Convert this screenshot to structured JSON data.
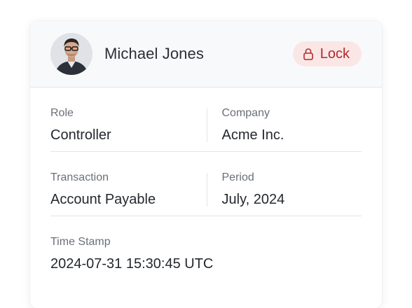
{
  "header": {
    "user_name": "Michael Jones",
    "avatar_icon": "user-photo",
    "lock": {
      "label": "Lock",
      "icon": "lock-icon"
    }
  },
  "fields": {
    "role": {
      "label": "Role",
      "value": "Controller"
    },
    "company": {
      "label": "Company",
      "value": "Acme Inc."
    },
    "transaction": {
      "label": "Transaction",
      "value": "Account Payable"
    },
    "period": {
      "label": "Period",
      "value": "July, 2024"
    },
    "timestamp": {
      "label": "Time Stamp",
      "value": "2024-07-31 15:30:45 UTC"
    }
  },
  "colors": {
    "lock_bg": "#fbe6e6",
    "lock_text": "#b12a2a",
    "header_bg": "#f8f9fb"
  }
}
